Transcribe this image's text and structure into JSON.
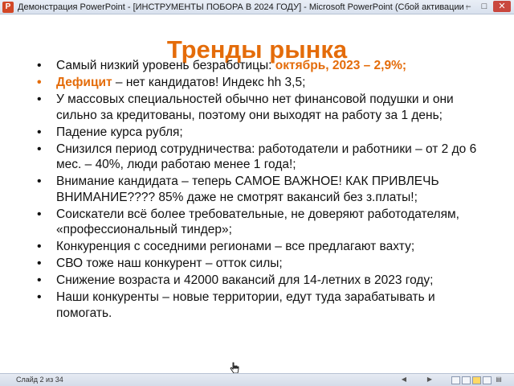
{
  "window": {
    "app_icon": "P",
    "title": "Демонстрация PowerPoint - [ИНСТРУМЕНТЫ ПОБОРА В 2024 ГОДУ] - Microsoft PowerPoint (Сбой активации пр...",
    "minimize": "–",
    "maximize": "□",
    "close": "✕"
  },
  "slide": {
    "title": "Тренды рынка",
    "bullet_symbol": "•",
    "bullets": [
      {
        "text": "Самый низкий уровень безработицы: ",
        "highlight": "октябрь, 2023 – 2,9%;"
      },
      {
        "highlight": "Дефицит",
        "text": " – нет кандидатов! Индекс hh 3,5;"
      },
      {
        "text": "У массовых специальностей обычно нет финансовой подушки и они сильно за кредитованы, поэтому они выходят на работу за 1 день;"
      },
      {
        "text": "Падение курса рубля;"
      },
      {
        "text": "Снизился период сотрудничества: работодатели и работники – от 2 до 6 мес. – 40%, люди работаю менее 1 года!;"
      },
      {
        "text": "Внимание кандидата – теперь САМОЕ ВАЖНОЕ! КАК ПРИВЛЕЧЬ ВНИМАНИЕ???? 85% даже не смотрят вакансий без з.платы!;"
      },
      {
        "text": "Соискатели всё более требовательные, не доверяют работодателям, «профессиональный тиндер»;"
      },
      {
        "text": "Конкуренция с соседними регионами – все предлагают вахту;"
      },
      {
        "text": "СВО тоже наш конкурент – отток силы;"
      },
      {
        "text": "Снижение возраста и 42000 вакансий для 14-летних в 2023 году;"
      },
      {
        "text": "Наши конкуренты – новые территории, едут туда зарабатывать и помогать."
      }
    ]
  },
  "statusbar": {
    "slide_counter": "Слайд 2 из 34"
  }
}
